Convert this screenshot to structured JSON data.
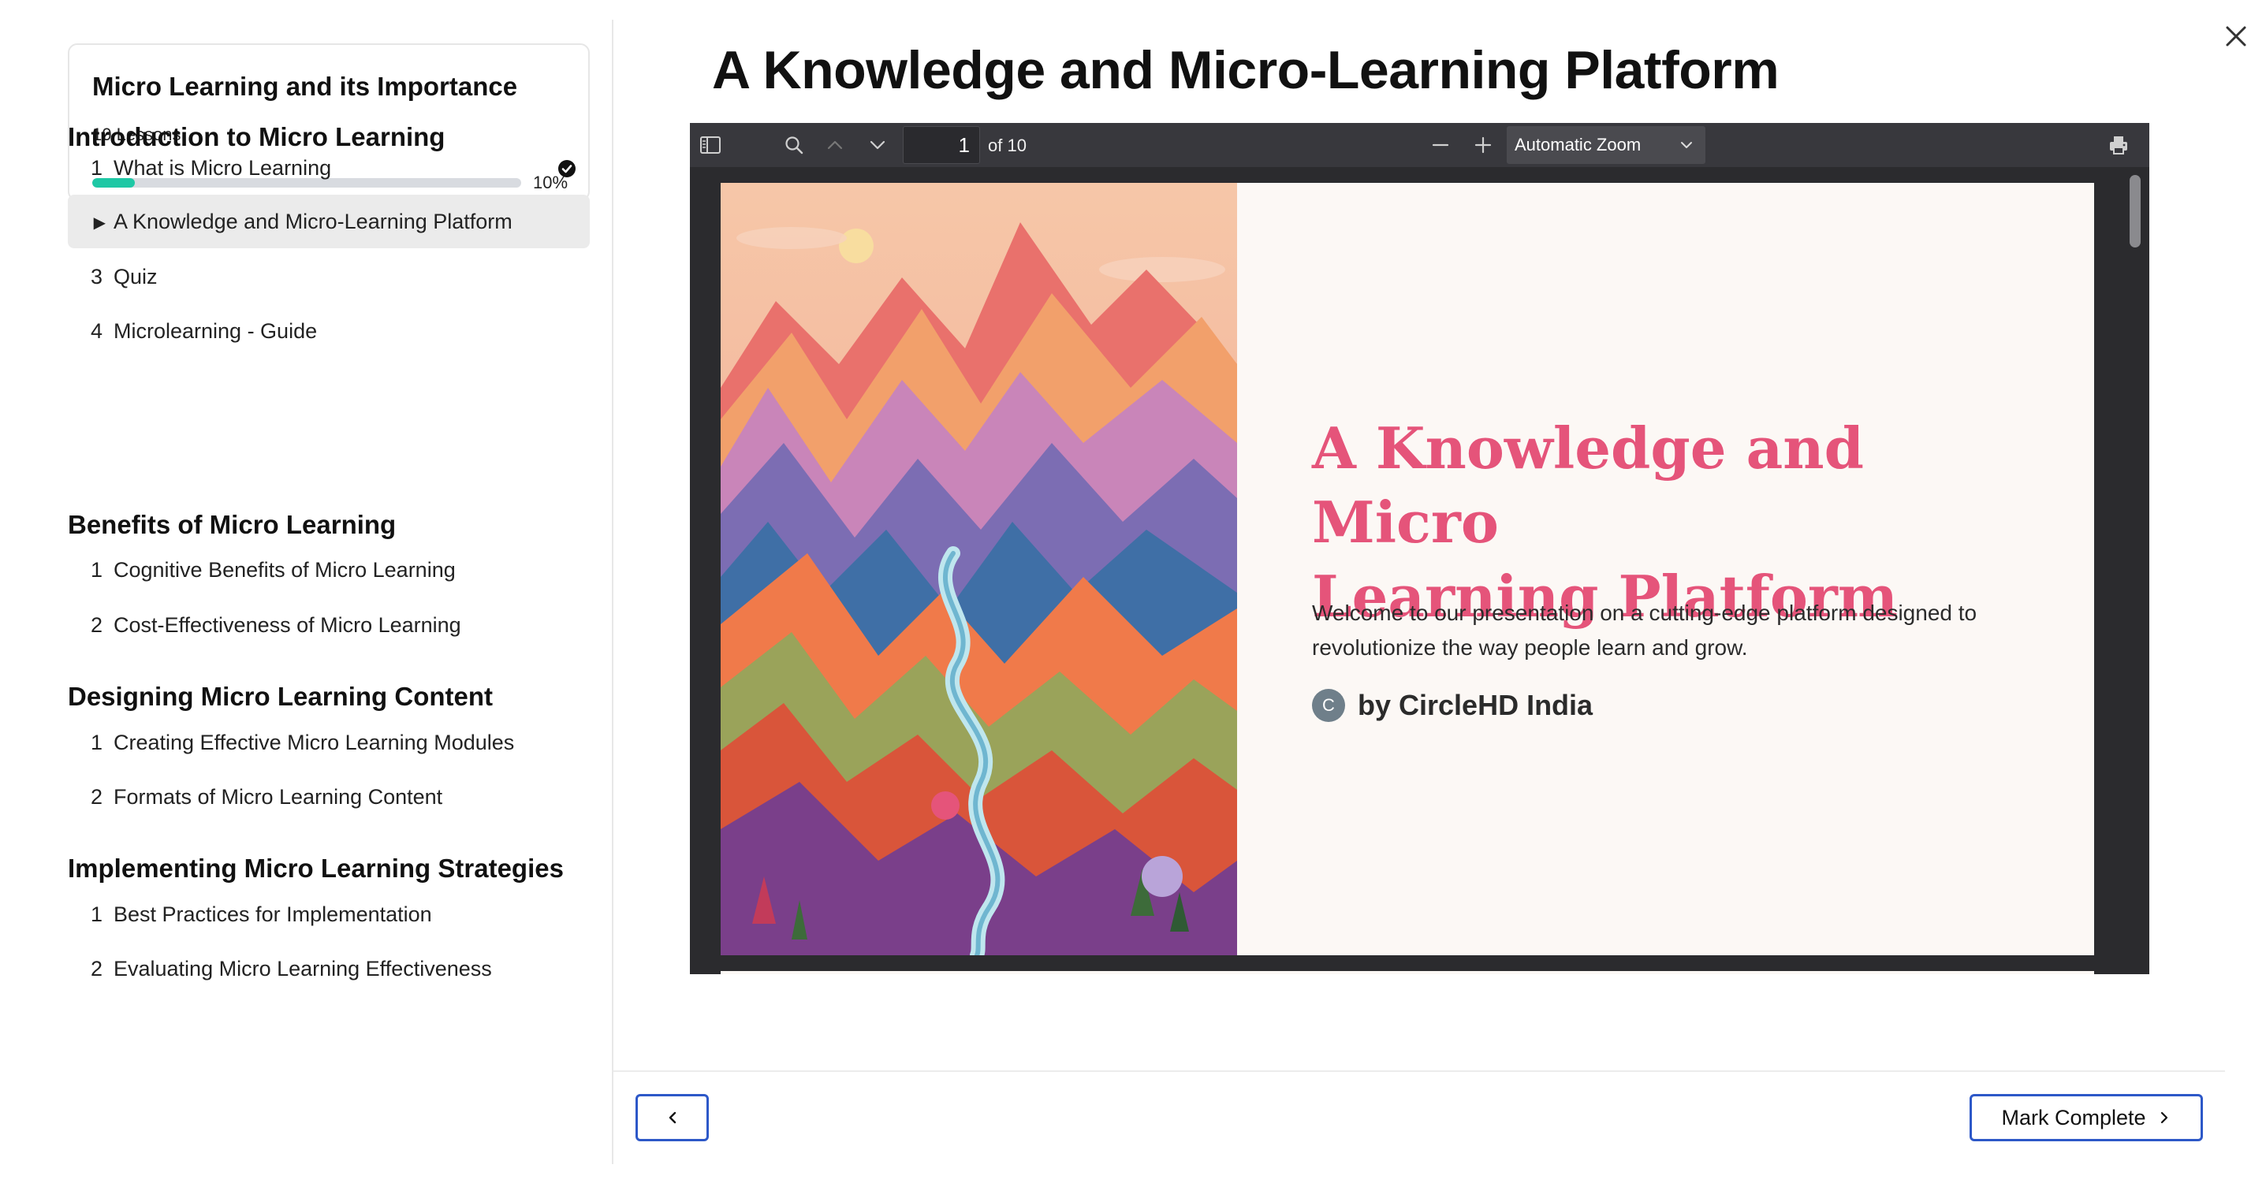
{
  "course": {
    "title": "Micro Learning and its Importance",
    "lessons_count": "10 Lessons",
    "progress_label": "10%",
    "progress_fraction": 0.1,
    "progress_color": "#1ec8a5"
  },
  "sections": [
    {
      "title": "Introduction to Micro Learning",
      "lessons": [
        {
          "num": "1",
          "title": "What is Micro Learning",
          "completed": true
        },
        {
          "num": "▶",
          "title": "A Knowledge and Micro-Learning Platform",
          "active": true
        },
        {
          "num": "3",
          "title": "Quiz"
        },
        {
          "num": "4",
          "title": "Microlearning - Guide"
        }
      ]
    },
    {
      "title": "Benefits of Micro Learning",
      "lessons": [
        {
          "num": "1",
          "title": "Cognitive Benefits of Micro Learning"
        },
        {
          "num": "2",
          "title": "Cost-Effectiveness of Micro Learning"
        }
      ]
    },
    {
      "title": "Designing Micro Learning Content",
      "lessons": [
        {
          "num": "1",
          "title": "Creating Effective Micro Learning Modules"
        },
        {
          "num": "2",
          "title": "Formats of Micro Learning Content"
        }
      ]
    },
    {
      "title": "Implementing Micro Learning Strategies",
      "lessons": [
        {
          "num": "1",
          "title": "Best Practices for Implementation"
        },
        {
          "num": "2",
          "title": "Evaluating Micro Learning Effectiveness"
        }
      ]
    }
  ],
  "main": {
    "title": "A Knowledge and Micro-Learning Platform"
  },
  "viewer": {
    "page_number": "1",
    "page_total": "of 10",
    "zoom": "Automatic Zoom",
    "icons": [
      "sidebar-toggle-icon",
      "search-icon",
      "chevron-up-icon",
      "chevron-down-icon",
      "zoom-out-icon",
      "zoom-in-icon",
      "print-icon"
    ]
  },
  "slide": {
    "title_line1": "A Knowledge and Micro",
    "title_line2": "Learning Platform",
    "body_line1": "Welcome to our presentation on a cutting-edge platform designed to",
    "body_line2": "revolutionize the way people learn and grow.",
    "author_initial": "C",
    "author": "by CircleHD India",
    "accent_color": "#e5547a"
  },
  "footer": {
    "complete_label": "Mark Complete"
  },
  "colors": {
    "button_border": "#2d58c8",
    "toolbar_bg": "#38383d",
    "viewer_bg": "#2b2b2e",
    "active_lesson_bg": "#ebebeb"
  }
}
